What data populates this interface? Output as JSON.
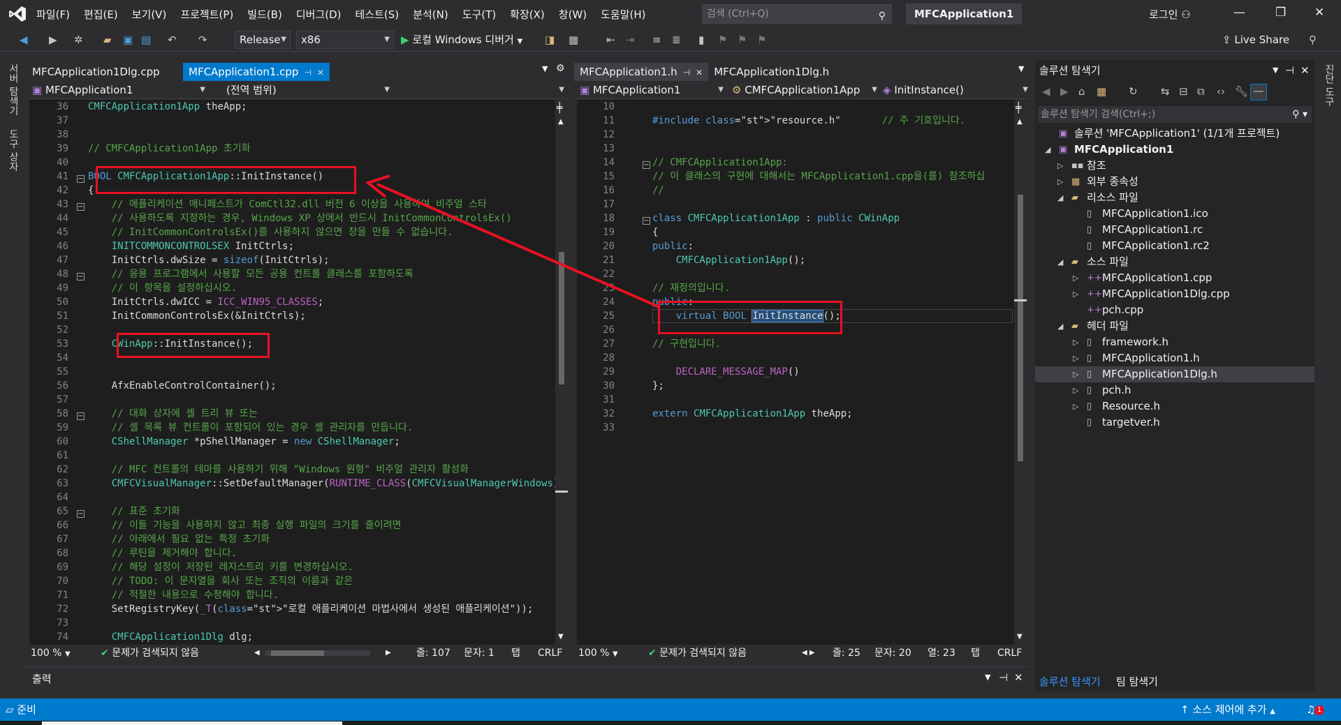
{
  "titlebar": {
    "menu": [
      "파일(F)",
      "편집(E)",
      "보기(V)",
      "프로젝트(P)",
      "빌드(B)",
      "디버그(D)",
      "테스트(S)",
      "분석(N)",
      "도구(T)",
      "확장(X)",
      "창(W)",
      "도움말(H)"
    ],
    "search_placeholder": "검색 (Ctrl+Q)",
    "app_title": "MFCApplication1",
    "login": "로그인"
  },
  "toolbar": {
    "config": "Release",
    "platform": "x86",
    "debugger": "로컬 Windows 디버거",
    "live_share": "Live Share"
  },
  "left_side_tabs": [
    "서버 탐색기",
    "도구 상자"
  ],
  "left_editor": {
    "tabs": [
      {
        "label": "MFCApplication1Dlg.cpp",
        "active": false
      },
      {
        "label": "MFCApplication1.cpp",
        "active": true
      }
    ],
    "nav_project": "MFCApplication1",
    "nav_scope": "(전역 범위)",
    "lines": [
      {
        "n": "36",
        "t": "CMFCApplication1App theApp;"
      },
      {
        "n": "37",
        "t": ""
      },
      {
        "n": "38",
        "t": ""
      },
      {
        "n": "39",
        "t": "// CMFCApplication1App 초기화"
      },
      {
        "n": "40",
        "t": ""
      },
      {
        "n": "41",
        "t": "BOOL CMFCApplication1App::InitInstance()"
      },
      {
        "n": "42",
        "t": "{"
      },
      {
        "n": "43",
        "t": "    // 애플리케이션 매니페스트가 ComCtl32.dll 버전 6 이상을 사용하여 비주얼 스타"
      },
      {
        "n": "44",
        "t": "    // 사용하도록 지정하는 경우, Windows XP 상에서 반드시 InitCommonControlsEx()"
      },
      {
        "n": "45",
        "t": "    // InitCommonControlsEx()를 사용하지 않으면 창을 만들 수 없습니다."
      },
      {
        "n": "46",
        "t": "    INITCOMMONCONTROLSEX InitCtrls;"
      },
      {
        "n": "47",
        "t": "    InitCtrls.dwSize = sizeof(InitCtrls);"
      },
      {
        "n": "48",
        "t": "    // 응용 프로그램에서 사용할 모든 공용 컨트롤 클래스를 포함하도록"
      },
      {
        "n": "49",
        "t": "    // 이 항목을 설정하십시오."
      },
      {
        "n": "50",
        "t": "    InitCtrls.dwICC = ICC_WIN95_CLASSES;"
      },
      {
        "n": "51",
        "t": "    InitCommonControlsEx(&InitCtrls);"
      },
      {
        "n": "52",
        "t": ""
      },
      {
        "n": "53",
        "t": "    CWinApp::InitInstance();"
      },
      {
        "n": "54",
        "t": ""
      },
      {
        "n": "55",
        "t": ""
      },
      {
        "n": "56",
        "t": "    AfxEnableControlContainer();"
      },
      {
        "n": "57",
        "t": ""
      },
      {
        "n": "58",
        "t": "    // 대화 상자에 셸 트리 뷰 또는"
      },
      {
        "n": "59",
        "t": "    // 셸 목록 뷰 컨트롤이 포함되어 있는 경우 셸 관리자를 만듭니다."
      },
      {
        "n": "60",
        "t": "    CShellManager *pShellManager = new CShellManager;"
      },
      {
        "n": "61",
        "t": ""
      },
      {
        "n": "62",
        "t": "    // MFC 컨트롤의 테마를 사용하기 위해 \"Windows 원형\" 비주얼 관리자 활성화"
      },
      {
        "n": "63",
        "t": "    CMFCVisualManager::SetDefaultManager(RUNTIME_CLASS(CMFCVisualManagerWindows)"
      },
      {
        "n": "64",
        "t": ""
      },
      {
        "n": "65",
        "t": "    // 표준 초기화"
      },
      {
        "n": "66",
        "t": "    // 이들 기능을 사용하지 않고 최종 실행 파일의 크기를 줄이려면"
      },
      {
        "n": "67",
        "t": "    // 아래에서 필요 없는 특정 초기화"
      },
      {
        "n": "68",
        "t": "    // 루틴을 제거해야 합니다."
      },
      {
        "n": "69",
        "t": "    // 해당 설정이 저장된 레지스트리 키를 변경하십시오."
      },
      {
        "n": "70",
        "t": "    // TODO: 이 문자열을 회사 또는 조직의 이름과 같은"
      },
      {
        "n": "71",
        "t": "    // 적절한 내용으로 수정해야 합니다."
      },
      {
        "n": "72",
        "t": "    SetRegistryKey(_T(\"로컬 애플리케이션 마법사에서 생성된 애플리케이션\"));"
      },
      {
        "n": "73",
        "t": ""
      },
      {
        "n": "74",
        "t": "    CMFCApplication1Dlg dlg;"
      }
    ],
    "zoom": "100 %",
    "issues": "문제가 검색되지 않음",
    "line": "줄: 107",
    "char": "문자: 1",
    "tab": "탭",
    "eol": "CRLF"
  },
  "right_editor": {
    "tabs": [
      {
        "label": "MFCApplication1.h",
        "active": false
      },
      {
        "label": "MFCApplication1Dlg.h",
        "active": false
      }
    ],
    "nav_project": "MFCApplication1",
    "nav_class": "CMFCApplication1App",
    "nav_member": "InitInstance()",
    "lines": [
      {
        "n": "10",
        "t": ""
      },
      {
        "n": "11",
        "t": "#include \"resource.h\"       // 주 기호입니다."
      },
      {
        "n": "12",
        "t": ""
      },
      {
        "n": "13",
        "t": ""
      },
      {
        "n": "14",
        "t": "// CMFCApplication1App:"
      },
      {
        "n": "15",
        "t": "// 이 클래스의 구현에 대해서는 MFCApplication1.cpp을(를) 참조하십"
      },
      {
        "n": "16",
        "t": "//"
      },
      {
        "n": "17",
        "t": ""
      },
      {
        "n": "18",
        "t": "class CMFCApplication1App : public CWinApp"
      },
      {
        "n": "19",
        "t": "{"
      },
      {
        "n": "20",
        "t": "public:"
      },
      {
        "n": "21",
        "t": "    CMFCApplication1App();"
      },
      {
        "n": "22",
        "t": ""
      },
      {
        "n": "23",
        "t": "// 재정의입니다."
      },
      {
        "n": "24",
        "t": "public:"
      },
      {
        "n": "25",
        "t": "    virtual BOOL InitInstance();"
      },
      {
        "n": "26",
        "t": ""
      },
      {
        "n": "27",
        "t": "// 구현입니다."
      },
      {
        "n": "28",
        "t": ""
      },
      {
        "n": "29",
        "t": "    DECLARE_MESSAGE_MAP()"
      },
      {
        "n": "30",
        "t": "};"
      },
      {
        "n": "31",
        "t": ""
      },
      {
        "n": "32",
        "t": "extern CMFCApplication1App theApp;"
      },
      {
        "n": "33",
        "t": ""
      }
    ],
    "zoom": "100 %",
    "issues": "문제가 검색되지 않음",
    "line": "줄: 25",
    "char": "문자: 20",
    "col": "열: 23",
    "tab": "탭",
    "eol": "CRLF"
  },
  "solution_explorer": {
    "title": "솔루션 탐색기",
    "search_placeholder": "솔루션 탐색기 검색(Ctrl+;)",
    "tree": [
      {
        "label": "솔루션 'MFCApplication1' (1/1개 프로젝트)",
        "depth": 0,
        "exp": "",
        "icon": "solution-icon"
      },
      {
        "label": "MFCApplication1",
        "depth": 0,
        "exp": "◢",
        "icon": "project-icon",
        "bold": true
      },
      {
        "label": "참조",
        "depth": 1,
        "exp": "▷",
        "icon": "references-icon"
      },
      {
        "label": "외부 종속성",
        "depth": 1,
        "exp": "▷",
        "icon": "external-deps-icon"
      },
      {
        "label": "리소스 파일",
        "depth": 1,
        "exp": "◢",
        "icon": "folder-icon"
      },
      {
        "label": "MFCApplication1.ico",
        "depth": 2,
        "exp": "",
        "icon": "file-icon"
      },
      {
        "label": "MFCApplication1.rc",
        "depth": 2,
        "exp": "",
        "icon": "file-icon"
      },
      {
        "label": "MFCApplication1.rc2",
        "depth": 2,
        "exp": "",
        "icon": "file-icon"
      },
      {
        "label": "소스 파일",
        "depth": 1,
        "exp": "◢",
        "icon": "folder-icon"
      },
      {
        "label": "MFCApplication1.cpp",
        "depth": 2,
        "exp": "▷",
        "icon": "cpp-file-icon"
      },
      {
        "label": "MFCApplication1Dlg.cpp",
        "depth": 2,
        "exp": "▷",
        "icon": "cpp-file-icon"
      },
      {
        "label": "pch.cpp",
        "depth": 2,
        "exp": "",
        "icon": "cpp-file-icon"
      },
      {
        "label": "헤더 파일",
        "depth": 1,
        "exp": "◢",
        "icon": "folder-icon"
      },
      {
        "label": "framework.h",
        "depth": 2,
        "exp": "▷",
        "icon": "header-file-icon"
      },
      {
        "label": "MFCApplication1.h",
        "depth": 2,
        "exp": "▷",
        "icon": "header-file-icon"
      },
      {
        "label": "MFCApplication1Dlg.h",
        "depth": 2,
        "exp": "▷",
        "icon": "header-file-icon",
        "selected": true
      },
      {
        "label": "pch.h",
        "depth": 2,
        "exp": "▷",
        "icon": "header-file-icon"
      },
      {
        "label": "Resource.h",
        "depth": 2,
        "exp": "▷",
        "icon": "header-file-icon"
      },
      {
        "label": "targetver.h",
        "depth": 2,
        "exp": "",
        "icon": "header-file-icon"
      }
    ],
    "bottom_tabs": [
      "솔루션 탐색기",
      "팀 탐색기"
    ]
  },
  "right_side_tabs": [
    "진단 도구"
  ],
  "output": {
    "title": "출력"
  },
  "status": {
    "ready": "준비",
    "source_control": "소스 제어에 추가",
    "notifications": "1"
  },
  "colors": {
    "accent": "#007acc",
    "annotation": "#e81123"
  }
}
